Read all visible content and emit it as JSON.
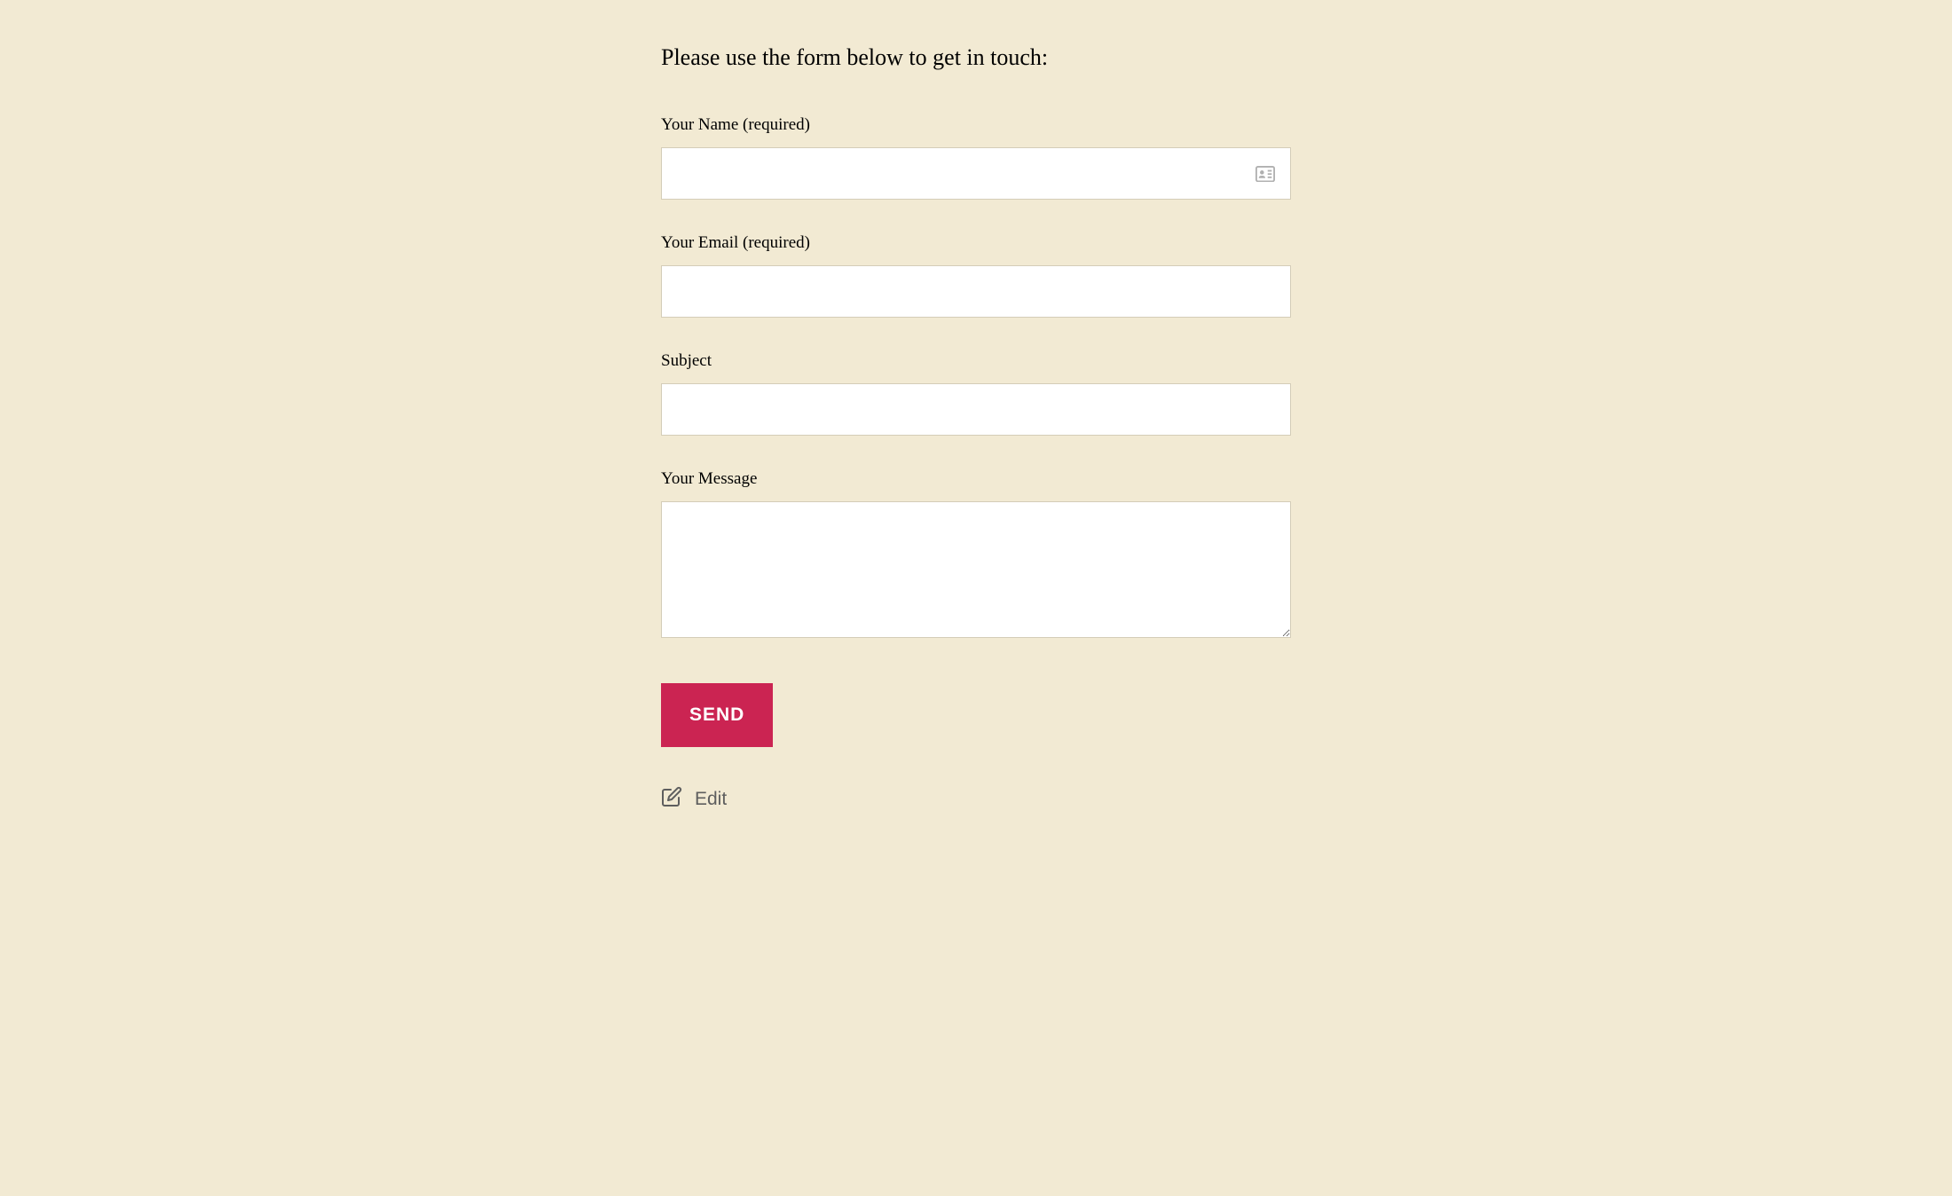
{
  "intro": "Please use the form below to get in touch:",
  "fields": {
    "name": {
      "label": "Your Name (required)",
      "value": ""
    },
    "email": {
      "label": "Your Email (required)",
      "value": ""
    },
    "subject": {
      "label": "Subject",
      "value": ""
    },
    "message": {
      "label": "Your Message",
      "value": ""
    }
  },
  "button": {
    "send": "SEND"
  },
  "edit_link": "Edit"
}
